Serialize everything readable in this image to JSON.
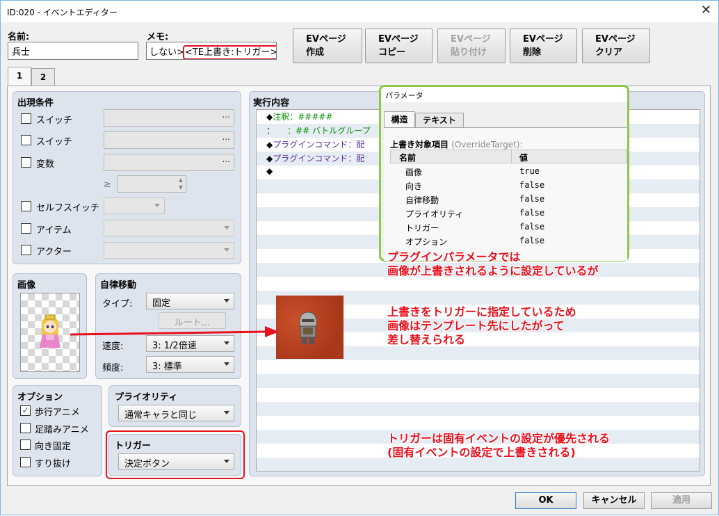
{
  "window": {
    "title": "ID:020 - イベントエディター",
    "close": "✕"
  },
  "name": {
    "label": "名前:",
    "value": "兵士"
  },
  "memo": {
    "label": "メモ:",
    "value_prefix": "しない>",
    "value_highlight": "<TE上書き:トリガー>"
  },
  "toolbar": [
    {
      "line1": "EVページ",
      "line2": "作成",
      "enabled": true
    },
    {
      "line1": "EVページ",
      "line2": "コピー",
      "enabled": true
    },
    {
      "line1": "EVページ",
      "line2": "貼り付け",
      "enabled": false
    },
    {
      "line1": "EVページ",
      "line2": "削除",
      "enabled": true
    },
    {
      "line1": "EVページ",
      "line2": "クリア",
      "enabled": true
    }
  ],
  "tabs": [
    "1",
    "2"
  ],
  "conditions": {
    "title": "出現条件",
    "switch1": "スイッチ",
    "switch2": "スイッチ",
    "variable": "変数",
    "gte": "≥",
    "selfswitch": "セルフスイッチ",
    "item": "アイテム",
    "actor": "アクター",
    "dots": "..."
  },
  "image": {
    "title": "画像"
  },
  "autonomous": {
    "title": "自律移動",
    "type_label": "タイプ:",
    "type_value": "固定",
    "route": "ルート...",
    "speed_label": "速度:",
    "speed_value": "3: 1/2倍速",
    "freq_label": "頻度:",
    "freq_value": "3: 標準"
  },
  "options": {
    "title": "オプション",
    "walk": "歩行アニメ",
    "step": "足踏みアニメ",
    "dirfix": "向き固定",
    "through": "すり抜け",
    "walk_checked": true
  },
  "priority": {
    "title": "プライオリティ",
    "value": "通常キャラと同じ"
  },
  "trigger": {
    "title": "トリガー",
    "value": "決定ボタン"
  },
  "contents": {
    "title": "実行内容",
    "lines": [
      {
        "bullet": "◆",
        "text": "注釈：#####",
        "color": "#009000"
      },
      {
        "bullet": "：",
        "text": "　　：## バトルグループ",
        "color": "#009000"
      },
      {
        "bullet": "◆",
        "text": "プラグインコマンド：配",
        "color": "#5a2ea0"
      },
      {
        "bullet": "◆",
        "text": "プラグインコマンド：配",
        "color": "#5a2ea0"
      },
      {
        "bullet": "◆",
        "text": "",
        "color": "#000"
      }
    ]
  },
  "param": {
    "title": "パラメータ",
    "tab_struct": "構造",
    "tab_text": "テキスト",
    "heading": "上書き対象項目",
    "heading_sub": "(OverrideTarget):",
    "col_name": "名前",
    "col_value": "値",
    "rows": [
      {
        "name": "画像",
        "value": "true"
      },
      {
        "name": "向き",
        "value": "false"
      },
      {
        "name": "自律移動",
        "value": "false"
      },
      {
        "name": "プライオリティ",
        "value": "false"
      },
      {
        "name": "トリガー",
        "value": "false"
      },
      {
        "name": "オプション",
        "value": "false"
      }
    ]
  },
  "annotations": {
    "a1_line1": "プラグインパラメータでは",
    "a1_line2": "画像が上書きされるように設定しているが",
    "a2_line1": "上書きをトリガーに指定しているため",
    "a2_line2": "画像はテンプレート先にしたがって",
    "a2_line3": "差し替えられる",
    "a3_line1": "トリガーは固有イベントの設定が優先される",
    "a3_line2": "(固有イベントの設定で上書きされる)"
  },
  "buttons": {
    "ok": "OK",
    "cancel": "キャンセル",
    "apply": "適用"
  },
  "colors": {
    "annotation": "#e8101c",
    "highlight_green": "#8cc84b",
    "accent_blue": "#7ab7e8"
  }
}
